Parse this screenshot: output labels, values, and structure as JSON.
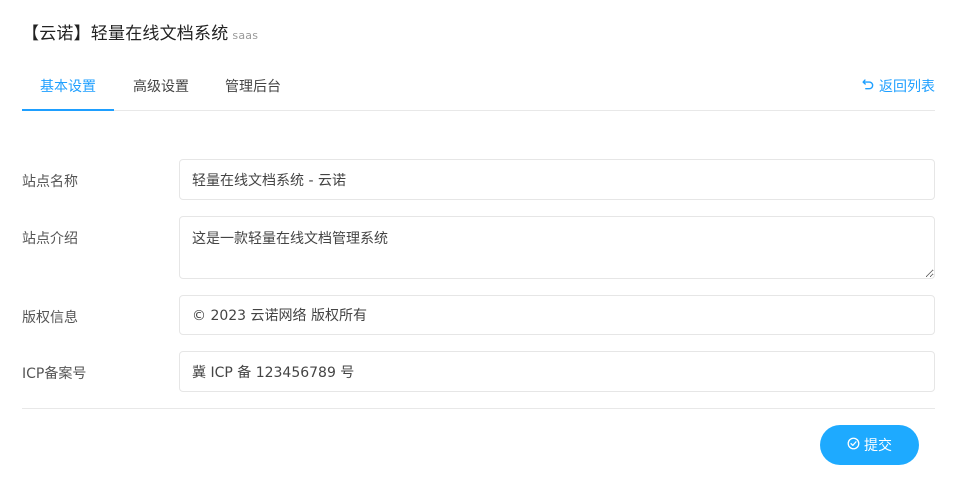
{
  "header": {
    "title": "【云诺】轻量在线文档系统",
    "subtitle": "saas"
  },
  "tabs": [
    {
      "label": "基本设置",
      "active": true
    },
    {
      "label": "高级设置",
      "active": false
    },
    {
      "label": "管理后台",
      "active": false
    }
  ],
  "back_link": {
    "label": "返回列表",
    "icon": "undo-icon"
  },
  "form": {
    "site_name": {
      "label": "站点名称",
      "value": "轻量在线文档系统 - 云诺"
    },
    "site_intro": {
      "label": "站点介绍",
      "value": "这是一款轻量在线文档管理系统"
    },
    "copyright": {
      "label": "版权信息",
      "value": "© 2023 云诺网络 版权所有"
    },
    "icp": {
      "label": "ICP备案号",
      "value": "冀 ICP 备 123456789 号"
    }
  },
  "submit": {
    "label": "提交",
    "icon": "check-circle-icon"
  },
  "colors": {
    "accent": "#1e9fff",
    "button": "#1eaaff",
    "border": "#e6e6e6"
  }
}
